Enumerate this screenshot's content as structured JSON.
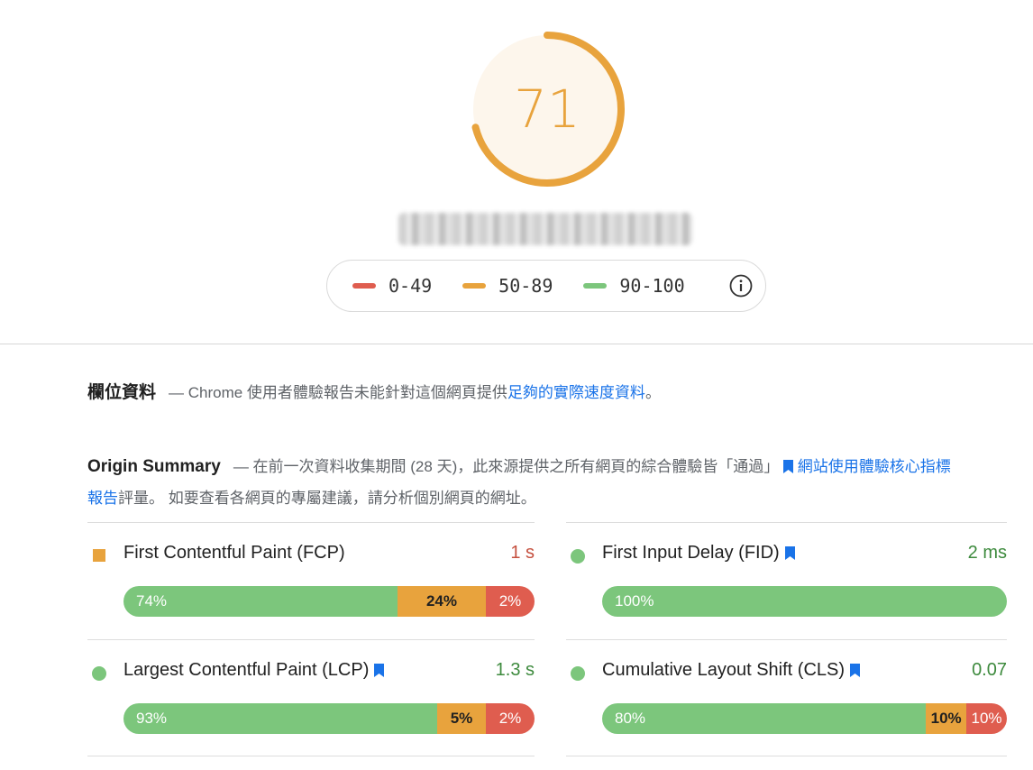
{
  "score": {
    "value": 71,
    "fraction": 0.71,
    "color": "#e8a33d"
  },
  "legend": [
    {
      "label": "0-49",
      "color": "#df5d4f"
    },
    {
      "label": "50-89",
      "color": "#e8a33d"
    },
    {
      "label": "90-100",
      "color": "#7cc67c"
    }
  ],
  "field": {
    "title": "欄位資料",
    "sep": "—",
    "text": "Chrome 使用者體驗報告未能針對這個網頁提供",
    "link": "足夠的實際速度資料",
    "end": "。"
  },
  "origin": {
    "title": "Origin Summary",
    "text": "— 在前一次資料收集期間 (28 天)，此來源提供之所有網頁的綜合體驗皆「通過」",
    "link": "網站使用體驗核心指標報告",
    "text2": "評量。 如要查看各網頁的專屬建議，請分析個別網頁的網址。"
  },
  "metrics": [
    {
      "name": "First Contentful Paint (FCP)",
      "value": "1 s",
      "status": "average",
      "value_color": "#c5503f",
      "dist": [
        {
          "pct": 74,
          "label": "74%"
        },
        {
          "pct": 24,
          "label": "24%"
        },
        {
          "pct": 2,
          "label": "2%"
        }
      ]
    },
    {
      "name": "First Input Delay (FID)",
      "value": "2 ms",
      "status": "good",
      "value_color": "#3d8a3d",
      "dist": [
        {
          "pct": 100,
          "label": "100%"
        }
      ]
    },
    {
      "name": "Largest Contentful Paint (LCP)",
      "value": "1.3 s",
      "status": "good",
      "value_color": "#3d8a3d",
      "dist": [
        {
          "pct": 93,
          "label": "93%"
        },
        {
          "pct": 5,
          "label": "5%"
        },
        {
          "pct": 2,
          "label": "2%"
        }
      ]
    },
    {
      "name": "Cumulative Layout Shift (CLS)",
      "value": "0.07",
      "status": "good",
      "value_color": "#3d8a3d",
      "dist": [
        {
          "pct": 80,
          "label": "80%"
        },
        {
          "pct": 10,
          "label": "10%"
        },
        {
          "pct": 10,
          "label": "10%"
        }
      ]
    }
  ]
}
